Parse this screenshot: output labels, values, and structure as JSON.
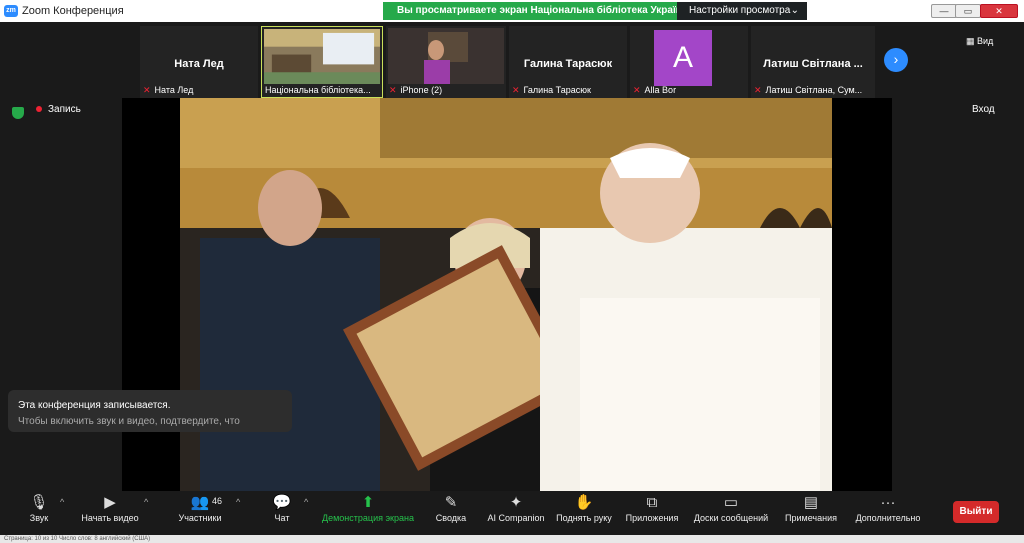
{
  "window": {
    "title": "Zoom Конференция",
    "logo": "zm"
  },
  "banner": {
    "sharing_text": "Вы просматриваете экран Національна бібліотека Україні...",
    "view_settings": "Настройки просмотра",
    "chevron": "⌄"
  },
  "window_controls": {
    "minimize": "—",
    "maximize": "▭",
    "close": "✕"
  },
  "participants": [
    {
      "name": "Ната Лед",
      "footer": "Ната Лед",
      "has_video": false
    },
    {
      "name": "",
      "footer": "Національна бібліотека...",
      "has_video": true
    },
    {
      "name": "",
      "footer": "iPhone (2)",
      "has_video": true
    },
    {
      "name": "Галина Тарасюк",
      "footer": "Галина Тарасюк",
      "has_video": false
    },
    {
      "name": "",
      "footer": "Alla Bor",
      "has_video": false,
      "avatar_letter": "A"
    },
    {
      "name": "Латиш Світлана ...",
      "footer": "Латиш Світлана, Сум...",
      "has_video": false
    }
  ],
  "strip": {
    "next_icon": "›",
    "view_label": "Вид"
  },
  "recording": {
    "label": "Запись"
  },
  "enter_label": "Вход",
  "notice": {
    "line1": "Эта конференция записывается.",
    "line2": "Чтобы включить звук и видео, подтвердите, что"
  },
  "toolbar": {
    "audio": "Звук",
    "audio_badge": "!",
    "video": "Начать видео",
    "participants": "Участники",
    "participants_count": "46",
    "chat": "Чат",
    "share": "Демонстрация экрана",
    "summary": "Сводка",
    "ai": "AI Companion",
    "raise_hand": "Поднять руку",
    "apps": "Приложения",
    "whiteboards": "Доски сообщений",
    "notes": "Примечания",
    "more": "Дополнительно",
    "exit": "Выйти",
    "caret": "^"
  },
  "taskbar": {
    "text": "Страница: 10 из 10 Число слов: 8 английский (США)"
  },
  "colors": {
    "accent": "#2d8cff",
    "share_green": "#26a94a",
    "exit_red": "#d42a2a",
    "avatar_purple": "#a346c8"
  }
}
